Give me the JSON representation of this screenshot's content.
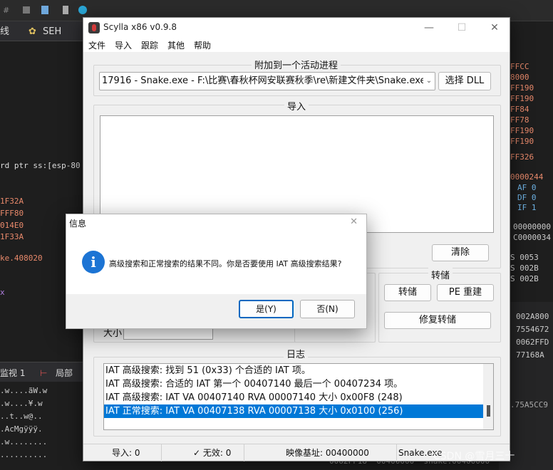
{
  "background": {
    "tabs": [
      "线",
      "SEH"
    ],
    "asm_snippet": "rd ptr ss:[esp-80",
    "left_lines": [
      "1F32A",
      "FFF80",
      "014E0",
      "1F33A"
    ],
    "left_label": "ke.408020",
    "left_x": "x",
    "bottom_tabs": [
      "监视 1",
      "局部"
    ],
    "dump_lines": [
      ".w....ãW.w",
      ".w....¥.w",
      "..t..w@..",
      ".AcMgÿÿÿ.",
      ".w........",
      ".........."
    ],
    "right_lines": [
      "FFCC",
      "8000",
      "FF190",
      "FF190",
      "FF84",
      "FF78",
      "FF190",
      "FF190",
      "FF326",
      "0000244",
      "AF 0",
      "DF 0",
      "IF 1",
      "00000000",
      "C0000034",
      "S 0053",
      "S 002B",
      "S 002B"
    ],
    "right_stack": [
      "002A800",
      "7554672",
      "0062FFD",
      "77168A",
      ".75A5CC9"
    ],
    "bottom_row": "0062FF18  00400000  snake.00400000",
    "watermark": "CSDN @雪月三十"
  },
  "window": {
    "title": "Scylla x86 v0.9.8",
    "menu": [
      "文件",
      "导入",
      "跟踪",
      "其他",
      "帮助"
    ],
    "attach_group": "附加到一个活动进程",
    "process": "17916 - Snake.exe - F:\\比赛\\春秋杯网安联赛秋季\\re\\新建文件夹\\Snake.exe",
    "select_dll": "选择 DLL",
    "imports_group": "导入",
    "clear": "清除",
    "dump_group": "转储",
    "dump": "转储",
    "pe_rebuild": "PE 重建",
    "fix_dump": "修复转储",
    "size_label": "大小",
    "log_group": "日志",
    "log": [
      "IAT 高级搜索: 找到 51 (0x33) 个合适的 IAT 项。",
      "IAT 高级搜索: 合适的 IAT 第一个 00407140 最后一个 00407234 项。",
      "IAT 高级搜索: IAT VA 00407140 RVA 00007140 大小 0x00F8 (248)",
      "IAT 正常搜索: IAT VA 00407138 RVA 00007138 大小 0x0100 (256)"
    ],
    "status": {
      "imports": "导入: 0",
      "invalid": "✓ 无效: 0",
      "image_base": "映像基址: 00400000",
      "module": "Snake.exe"
    }
  },
  "dialog": {
    "title": "信息",
    "message": "高级搜索和正常搜索的结果不同。你是否要使用 IAT 高级搜索结果?",
    "yes": "是(Y)",
    "no": "否(N)"
  },
  "colors": {
    "accent": "#0078d7",
    "info_icon": "#1c74d4",
    "debugger_orange": "#e8896b",
    "debugger_blue": "#6fb4e6"
  }
}
